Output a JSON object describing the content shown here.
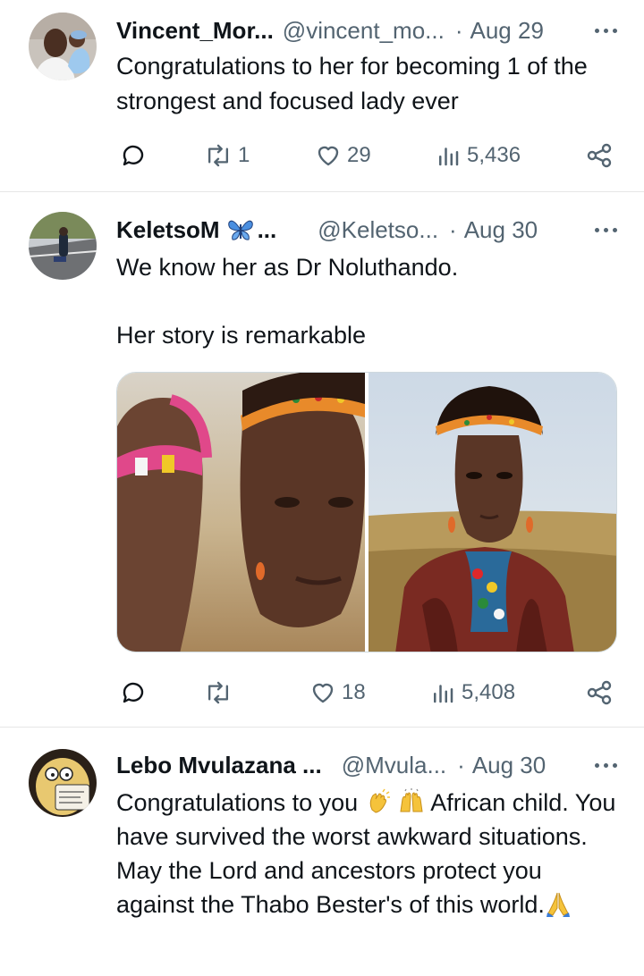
{
  "tweets": [
    {
      "name": "Vincent_Mor...",
      "handle": "@vincent_mo...",
      "sep": "·",
      "date": "Aug 29",
      "text": "Congratulations to her for becoming 1 of the strongest and focused lady ever",
      "stats": {
        "reposts": "1",
        "likes": "29",
        "views": "5,436"
      }
    },
    {
      "name": "KeletsoM",
      "name_suffix": "...",
      "handle": "@Keletso...",
      "sep": "·",
      "date": "Aug 30",
      "text_line1": "We know her as Dr Noluthando.",
      "text_line2": "Her story is remarkable",
      "stats": {
        "reposts": "",
        "likes": "18",
        "views": "5,408"
      }
    },
    {
      "name": "Lebo Mvulazana ...",
      "handle": "@Mvula...",
      "sep": "·",
      "date": "Aug 30",
      "text_part1": "Congratulations to you",
      "text_part2": "African child. You have survived the worst awkward situations. May the Lord and ancestors protect you against the Thabo Bester's of this world."
    }
  ],
  "icons": {
    "reply": "speech-bubble-icon",
    "repost": "repost-icon",
    "like": "heart-icon",
    "views": "bar-chart-icon",
    "share": "share-icon",
    "more": "ellipsis-icon",
    "butterfly": "butterfly-emoji",
    "clap": "clapping-hands-emoji",
    "raise": "raising-hands-emoji",
    "pray": "folded-hands-emoji"
  },
  "colors": {
    "text": "#0f1419",
    "muted": "#536471",
    "divider": "#e6e6e6",
    "butterfly": "#4a8fe0"
  }
}
